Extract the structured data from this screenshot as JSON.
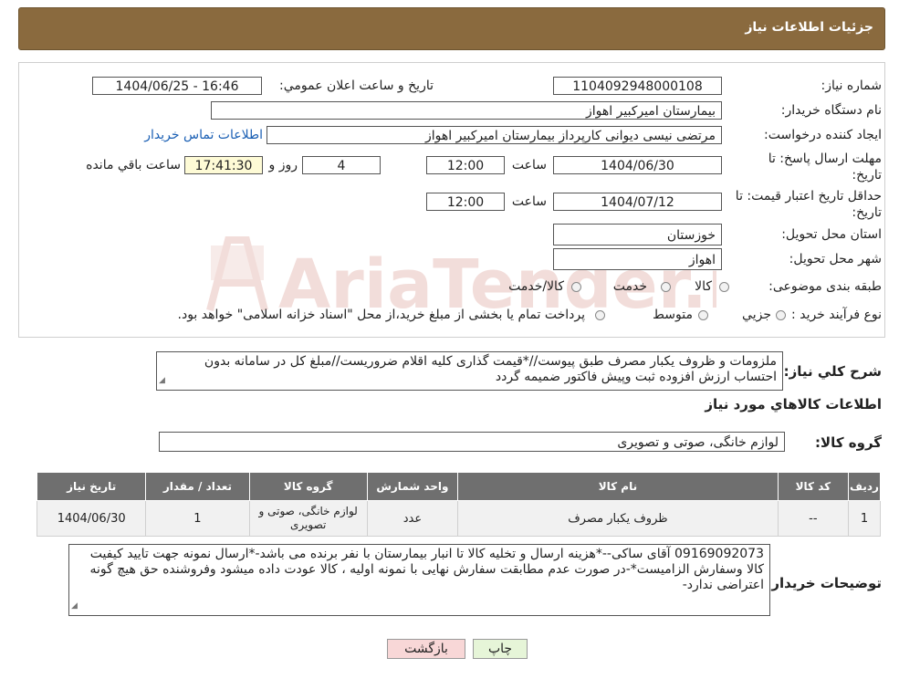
{
  "header": {
    "title": "جزئیات اطلاعات نیاز"
  },
  "fields": {
    "need_number": {
      "label": "شماره نیاز:",
      "value": "1104092948000108"
    },
    "announce_datetime": {
      "label": "تاریخ و ساعت اعلان عمومي:",
      "value": "1404/06/25 - 16:46"
    },
    "buyer_org": {
      "label": "نام دستگاه خريدار:",
      "value": "بیمارستان امیرکبیر اهواز"
    },
    "requester": {
      "label": "ايجاد کننده درخواست:",
      "value": "مرتضی نیسی دیوانی کارپرداز بیمارستان امیرکبیر اهواز",
      "contact_link": "اطلاعات تماس خريدار"
    },
    "reply_deadline": {
      "label": "مهلت ارسال پاسخ: تا تاريخ:",
      "date": "1404/06/30",
      "time_label": "ساعت",
      "time": "12:00",
      "days": "4",
      "days_label": "روز و",
      "remaining": "17:41:30",
      "remaining_label": "ساعت باقي مانده"
    },
    "price_validity": {
      "label": "حداقل تاريخ اعتبار قيمت: تا تاريخ:",
      "date": "1404/07/12",
      "time_label": "ساعت",
      "time": "12:00"
    },
    "province": {
      "label": "استان محل تحويل:",
      "value": "خوزستان"
    },
    "city": {
      "label": "شهر محل تحويل:",
      "value": "اهواز"
    },
    "category": {
      "label": "طبقه بندی موضوعی:",
      "options": [
        "کالا",
        "خدمت",
        "کالا/خدمت"
      ]
    },
    "purchase_type": {
      "label": "نوع فرآيند خريد :",
      "options": [
        "جزيي",
        "متوسط"
      ],
      "note": "پرداخت تمام یا بخشی از مبلغ خرید،از محل \"اسناد خزانه اسلامی\" خواهد بود."
    }
  },
  "description": {
    "label": "شرح كلي نياز:",
    "text": "ملزومات و ظروف یکبار مصرف طبق پیوست//*قیمت گذاری کلیه اقلام ضروریست//مبلغ کل در سامانه بدون احتساب ارزش افزوده ثبت وپیش فاکتور ضمیمه گردد"
  },
  "goods_section": {
    "title": "اطلاعات كالاهاي مورد نياز",
    "group_label": "گروه کالا:",
    "group_value": "لوازم خانگی، صوتی و تصویری"
  },
  "table": {
    "headers": [
      "رديف",
      "کد کالا",
      "نام کالا",
      "واحد شمارش",
      "گروه کالا",
      "تعداد / مقدار",
      "تاريخ نياز"
    ],
    "rows": [
      {
        "row": "1",
        "code": "--",
        "name": "ظروف یکبار مصرف",
        "unit": "عدد",
        "group": "لوازم خانگی، صوتی و تصویری",
        "qty": "1",
        "date": "1404/06/30"
      }
    ]
  },
  "buyer_notes": {
    "label": "توضيحات خريدار:",
    "text": "09169092073 آقای ساکی--*هزینه ارسال و تخلیه کالا تا انبار بیمارستان با نفر برنده می باشد-*ارسال نمونه جهت تایید کیفیت کالا وسفارش الزامیست*-در صورت عدم مطابقت سفارش نهایی با نمونه اولیه ، کالا عودت داده میشود وفروشنده حق هیچ گونه اعتراضی ندارد-"
  },
  "buttons": {
    "print": "چاپ",
    "back": "بازگشت"
  },
  "watermark": {
    "text": "AriaTender.neT"
  },
  "colors": {
    "header_bg": "#8a6a3e",
    "table_header": "#6f6f6f",
    "remaining_bg": "#fefbd6",
    "back_btn": "#f8d7d7",
    "print_btn": "#e6f5d8",
    "link": "#1a5fb4"
  },
  "icons": {
    "watermark_logo": "aria-tender-logo-icon",
    "resize": "resize-grip-icon"
  }
}
